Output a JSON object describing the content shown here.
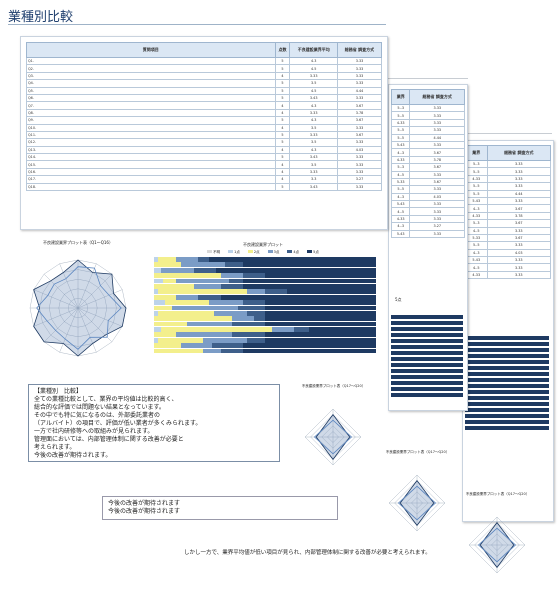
{
  "page_title": "業種別比較",
  "table": {
    "headers": [
      "質問項目",
      "点数",
      "不良建設業界平均",
      "総務省 調査方式"
    ],
    "rows": [
      [
        "Q1. ",
        "5",
        "4.3",
        "3.33"
      ],
      [
        "Q2. ",
        "5",
        "4.5",
        "3.33"
      ],
      [
        "Q3. ",
        "4",
        "3.33",
        "3.33"
      ],
      [
        "Q4. ",
        "5",
        "3.5",
        "3.33"
      ],
      [
        "Q5. ",
        "5",
        "4.5",
        "4.44"
      ],
      [
        "Q6. ",
        "5",
        "3.43",
        "3.33"
      ],
      [
        "Q7. ",
        "4",
        "4.3",
        "3.67"
      ],
      [
        "Q8. ",
        "4",
        "3.33",
        "3.78"
      ],
      [
        "Q9. ",
        "5",
        "4.3",
        "3.67"
      ],
      [
        "Q10. ",
        "4",
        "3.5",
        "3.33"
      ],
      [
        "Q11. ",
        "5",
        "3.33",
        "3.67"
      ],
      [
        "Q12. ",
        "5",
        "3.5",
        "3.33"
      ],
      [
        "Q13. ",
        "4",
        "4.3",
        "4.03"
      ],
      [
        "Q14. ",
        "5",
        "3.43",
        "3.33"
      ],
      [
        "Q15. ",
        "4",
        "3.5",
        "3.33"
      ],
      [
        "Q16. ",
        "4",
        "3.33",
        "3.33"
      ],
      [
        "Q17. ",
        "4",
        "3.3",
        "3.27"
      ],
      [
        "Q18. ",
        "5",
        "3.43",
        "3.33"
      ]
    ]
  },
  "mini_table_header_a": "総務省 調査方式",
  "mini_table_header_b": "総務省 調査方式",
  "mini_table_header_cut": "業界",
  "radar_main_title": "不良建設業界プロット表（Q1〜Q16）",
  "radar_small_title": "不良建設業界プロット表（Q17〜Q20）",
  "bar_chart_title": "不良建設業界プロット",
  "legend_items": [
    "不明",
    "1点",
    "2点",
    "3点",
    "4点",
    "5点"
  ],
  "navy_label": "5点",
  "note": {
    "title": "【業種別　比較】",
    "lines": [
      "全ての業種比較として、業界の平均値は比較的高く、",
      "総合的な評価では問題ない結果となっています。",
      "その中でも特に気になるのは、外部委託業者の",
      "（アルバイト）の項目で、評価が低い業者が多くみられます。",
      "一方で社内研修等への取組みが見られます。",
      "管理面においては、内部管理体制に関する改善が必要と",
      "考えられます。",
      "今後の改善が期待されます。"
    ]
  },
  "tail_lines": [
    "今後の改善が期待されます",
    "今後の改善が期待されます"
  ],
  "tail_bottom": "しかし一方で、業界平均値が低い項目が見られ、内部管理体制に関する改善が必要と考えられます。"
}
